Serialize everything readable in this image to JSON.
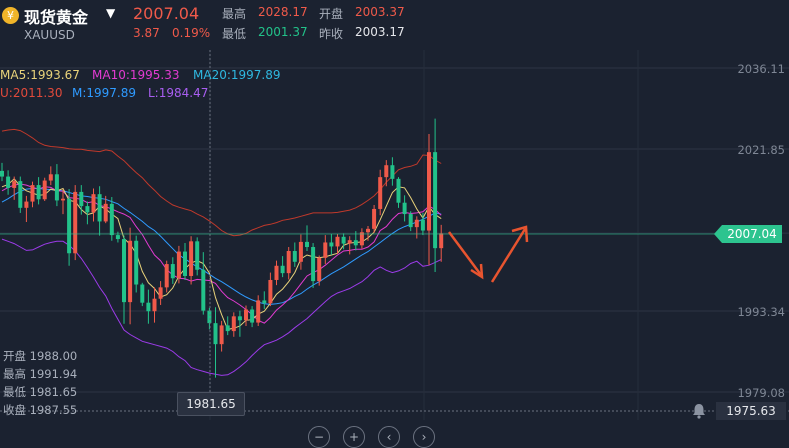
{
  "header": {
    "coin_glyph": "¥",
    "symbol_name": "现货黄金",
    "symbol_code": "XAUUSD",
    "price": "2007.04",
    "change": "3.87",
    "change_pct": "0.19%",
    "high_label": "最高",
    "high_value": "2028.17",
    "open_label": "开盘",
    "open_value": "2003.37",
    "low_label": "最低",
    "low_value": "2001.37",
    "prev_close_label": "昨收",
    "prev_close_value": "2003.17"
  },
  "indicators": {
    "ma5": "MA5:1993.67",
    "ma10": "MA10:1995.33",
    "ma20": "MA20:1997.89",
    "boll_u": "U:2011.30",
    "boll_m": "M:1997.89",
    "boll_l": "L:1984.47"
  },
  "ohlc_panel": {
    "open": "开盘 1988.00",
    "high": "最高 1991.94",
    "low": "最低 1981.65",
    "close": "收盘 1987.55"
  },
  "crosshair_low_label": "1981.65",
  "current_price_tag": "2007.04",
  "alert_price": "1975.63",
  "colors": {
    "up": "#f05a4a",
    "down": "#22c28a",
    "ma5": "#e8d27a",
    "ma10": "#e23bd1",
    "ma20": "#2f9bff",
    "boll_u": "#c0392b",
    "boll_l": "#9b3be8",
    "arrow": "#e8542f"
  },
  "chart_data": {
    "type": "candlestick",
    "y_ticks": [
      2036.11,
      2021.85,
      2007.04,
      1993.34,
      1979.08
    ],
    "ylim": [
      1975.0,
      2039.0
    ],
    "candles": [
      [
        2018.0,
        2019.4,
        2016.2,
        2017.0
      ],
      [
        2017.0,
        2018.1,
        2013.8,
        2015.0
      ],
      [
        2015.0,
        2017.0,
        2012.9,
        2016.2
      ],
      [
        2016.2,
        2017.0,
        2010.6,
        2011.5
      ],
      [
        2011.5,
        2013.6,
        2009.0,
        2012.6
      ],
      [
        2012.6,
        2016.1,
        2011.6,
        2015.5
      ],
      [
        2015.5,
        2016.9,
        2012.1,
        2013.0
      ],
      [
        2013.0,
        2016.8,
        2012.7,
        2016.3
      ],
      [
        2016.3,
        2018.8,
        2015.5,
        2017.4
      ],
      [
        2017.4,
        2019.2,
        2011.8,
        2012.8
      ],
      [
        2012.8,
        2014.7,
        2010.4,
        2013.1
      ],
      [
        2013.1,
        2014.8,
        2001.3,
        2003.5
      ],
      [
        2003.5,
        2015.5,
        2002.3,
        2014.3
      ],
      [
        2014.3,
        2015.5,
        2010.3,
        2011.8
      ],
      [
        2011.8,
        2012.6,
        2008.6,
        2010.7
      ],
      [
        2010.7,
        2014.9,
        2009.1,
        2013.9
      ],
      [
        2013.9,
        2015.3,
        2006.6,
        2009.1
      ],
      [
        2009.1,
        2013.6,
        2008.8,
        2012.2
      ],
      [
        2012.2,
        2013.4,
        2005.7,
        2006.7
      ],
      [
        2006.7,
        2007.3,
        2005.4,
        2006.0
      ],
      [
        2006.0,
        2006.6,
        1991.1,
        1994.9
      ],
      [
        1994.9,
        2008.0,
        1991.0,
        2005.7
      ],
      [
        2005.7,
        2006.6,
        1996.6,
        1998.0
      ],
      [
        1998.0,
        1998.3,
        1994.2,
        1994.8
      ],
      [
        1994.8,
        1997.1,
        1991.1,
        1993.3
      ],
      [
        1993.3,
        1997.5,
        1991.3,
        1995.5
      ],
      [
        1995.5,
        1998.6,
        1994.4,
        1997.5
      ],
      [
        1997.5,
        2002.2,
        1996.6,
        2001.6
      ],
      [
        2001.6,
        2002.8,
        1998.1,
        1999.1
      ],
      [
        1999.1,
        2004.8,
        1998.2,
        2003.8
      ],
      [
        2003.8,
        2005.3,
        1998.8,
        1999.5
      ],
      [
        1999.5,
        2006.5,
        1998.0,
        2005.6
      ],
      [
        2005.6,
        2006.3,
        1999.6,
        2000.6
      ],
      [
        2000.6,
        2003.7,
        1992.7,
        1993.4
      ],
      [
        1993.4,
        1993.9,
        1990.1,
        1991.2
      ],
      [
        1991.2,
        1994.0,
        1981.6,
        1987.5
      ],
      [
        1987.5,
        1991.6,
        1986.2,
        1990.8
      ],
      [
        1990.8,
        1992.4,
        1989.1,
        1989.8
      ],
      [
        1989.8,
        1993.1,
        1988.8,
        1992.4
      ],
      [
        1992.4,
        1993.4,
        1988.8,
        1991.7
      ],
      [
        1991.7,
        1994.3,
        1990.7,
        1993.6
      ],
      [
        1993.6,
        1994.2,
        1990.5,
        1991.3
      ],
      [
        1991.3,
        1996.1,
        1990.7,
        1995.2
      ],
      [
        1995.2,
        1996.8,
        1993.7,
        1994.7
      ],
      [
        1994.7,
        2000.1,
        1994.2,
        1998.8
      ],
      [
        1998.8,
        2002.2,
        1997.9,
        2001.3
      ],
      [
        2001.3,
        2003.0,
        1999.3,
        2000.0
      ],
      [
        2000.0,
        2004.6,
        1998.9,
        2003.9
      ],
      [
        2003.9,
        2005.4,
        2001.1,
        2002.0
      ],
      [
        2002.0,
        2006.8,
        2000.6,
        2005.5
      ],
      [
        2005.5,
        2008.4,
        2003.9,
        2004.6
      ],
      [
        2004.6,
        2005.3,
        1997.4,
        1998.6
      ],
      [
        1998.6,
        2003.1,
        1997.8,
        2002.7
      ],
      [
        2002.7,
        2006.7,
        2001.6,
        2005.4
      ],
      [
        2005.4,
        2006.9,
        2003.2,
        2004.7
      ],
      [
        2004.7,
        2006.9,
        2003.4,
        2006.4
      ],
      [
        2006.4,
        2007.0,
        2004.2,
        2005.2
      ],
      [
        2005.2,
        2006.5,
        2003.3,
        2005.8
      ],
      [
        2005.8,
        2007.4,
        2004.0,
        2004.9
      ],
      [
        2004.9,
        2007.9,
        2004.3,
        2007.2
      ],
      [
        2007.2,
        2008.3,
        2005.7,
        2007.8
      ],
      [
        2007.8,
        2012.0,
        2007.1,
        2011.3
      ],
      [
        2011.3,
        2018.2,
        2010.2,
        2016.9
      ],
      [
        2016.9,
        2019.9,
        2015.3,
        2019.0
      ],
      [
        2019.0,
        2020.4,
        2015.4,
        2016.6
      ],
      [
        2016.6,
        2016.9,
        2011.5,
        2012.4
      ],
      [
        2012.4,
        2013.7,
        2009.1,
        2010.4
      ],
      [
        2010.4,
        2010.9,
        2007.4,
        2008.1
      ],
      [
        2008.1,
        2010.0,
        2006.1,
        2009.4
      ],
      [
        2009.4,
        2010.6,
        2006.7,
        2007.5
      ],
      [
        2007.5,
        2024.5,
        2001.4,
        2021.3
      ],
      [
        2021.3,
        2027.2,
        2000.2,
        2004.4
      ],
      [
        2004.4,
        2008.5,
        2002.0,
        2007.0
      ]
    ],
    "ma5": [
      2015.2,
      2015.6,
      2016.6,
      2015.3,
      2014.5,
      2014.1,
      2013.7,
      2013.8,
      2014.8,
      2014.5,
      2014.9,
      2012.8,
      2012.6,
      2011.2,
      2010.3,
      2010.6,
      2011.8,
      2011.3,
      2010.4,
      2009.6,
      2006.1,
      2005.1,
      2003.5,
      2000.3,
      1998.3,
      1997.3,
      1995.8,
      1996.2,
      1997.4,
      1999.5,
      2000.8,
      2001.8,
      2002.2,
      2001.7,
      2000.0,
      1995.7,
      1992.7,
      1990.1,
      1990.3,
      1990.7,
      1991.7,
      1991.8,
      1992.8,
      1993.3,
      1994.7,
      1996.3,
      1997.2,
      1998.5,
      2000.1,
      2002.5,
      2003.2,
      2002.9,
      2002.7,
      2002.9,
      2003.2,
      2003.5,
      2004.9,
      2005.3,
      2005.4,
      2005.5,
      2006.2,
      2007.2,
      2009.4,
      2011.8,
      2014.2,
      2015.2,
      2015.0,
      2013.3,
      2011.3,
      2009.7,
      2011.7,
      2010.3,
      2009.6
    ],
    "ma10": [
      2014.5,
      2015.1,
      2015.5,
      2015.7,
      2015.5,
      2015.1,
      2014.8,
      2015.2,
      2015.1,
      2014.5,
      2014.4,
      2013.3,
      2013.2,
      2013.0,
      2012.4,
      2012.6,
      2011.9,
      2011.7,
      2011.3,
      2010.8,
      2010.4,
      2009.8,
      2008.2,
      2006.8,
      2004.9,
      2003.2,
      2002.2,
      2000.6,
      1999.7,
      1999.1,
      1999.0,
      1998.6,
      1998.9,
      1998.8,
      1998.7,
      1998.2,
      1996.8,
      1995.7,
      1995.1,
      1994.4,
      1993.6,
      1992.7,
      1991.7,
      1991.2,
      1992.2,
      1993.5,
      1994.4,
      1995.4,
      1996.7,
      1998.1,
      1999.5,
      2000.1,
      2000.6,
      2001.4,
      2002.3,
      2003.2,
      2003.9,
      2004.0,
      2004.2,
      2004.2,
      2004.6,
      2005.5,
      2007.5,
      2008.2,
      2009.5,
      2010.5,
      2010.7,
      2010.5,
      2010.6,
      2010.8,
      2011.8,
      2011.2,
      2010.2
    ],
    "ma20": [
      2012.5,
      2013.1,
      2013.8,
      2014.4,
      2014.8,
      2014.9,
      2014.9,
      2014.8,
      2014.7,
      2014.6,
      2014.5,
      2014.2,
      2013.9,
      2013.6,
      2013.5,
      2013.3,
      2013.2,
      2013.0,
      2012.6,
      2012.2,
      2011.4,
      2010.7,
      2009.9,
      2009.1,
      2008.2,
      2007.5,
      2006.5,
      2005.4,
      2004.3,
      2003.2,
      2002.5,
      2001.8,
      2001.1,
      2000.5,
      1999.8,
      1999.1,
      1998.5,
      1997.8,
      1997.1,
      1996.4,
      1995.8,
      1995.3,
      1994.9,
      1994.6,
      1994.5,
      1994.6,
      1994.8,
      1995.3,
      1995.9,
      1996.4,
      1997.2,
      1997.9,
      1998.5,
      1999.2,
      1999.9,
      2000.5,
      2001.1,
      2001.8,
      2002.5,
      2003.2,
      2003.8,
      2004.6,
      2005.4,
      2006.2,
      2007.0,
      2007.7,
      2008.2,
      2008.6,
      2009.0,
      2009.5,
      2010.0,
      2010.6,
      2010.4
    ],
    "boll_u": [
      2025.0,
      2025.2,
      2025.3,
      2025.1,
      2024.5,
      2023.8,
      2023.0,
      2022.5,
      2022.3,
      2022.2,
      2022.1,
      2021.9,
      2021.8,
      2021.8,
      2021.6,
      2021.5,
      2021.4,
      2021.7,
      2021.5,
      2020.6,
      2019.8,
      2018.7,
      2017.7,
      2016.8,
      2015.6,
      2014.6,
      2013.5,
      2012.7,
      2012.0,
      2011.6,
      2011.3,
      2011.0,
      2010.4,
      2009.9,
      2009.2,
      2008.4,
      2007.5,
      2006.9,
      2006.6,
      2006.7,
      2007.0,
      2007.6,
      2008.0,
      2008.4,
      2008.6,
      2008.9,
      2009.3,
      2009.5,
      2009.7,
      2010.0,
      2010.3,
      2010.6,
      2010.6,
      2010.6,
      2010.6,
      2010.7,
      2010.9,
      2011.1,
      2011.5,
      2012.1,
      2012.8,
      2013.6,
      2014.7,
      2016.0,
      2017.1,
      2018.2,
      2018.6,
      2018.8,
      2019.2,
      2020.8,
      2020.7,
      2019.9,
      2019.3
    ],
    "boll_l": [
      2006.0,
      2005.6,
      2005.2,
      2004.6,
      2004.0,
      2004.1,
      2004.6,
      2005.1,
      2005.4,
      2005.6,
      2005.6,
      2004.9,
      2003.9,
      2002.6,
      2001.0,
      1999.3,
      1997.5,
      1996.0,
      1993.8,
      1991.9,
      1990.0,
      1989.2,
      1988.6,
      1988.0,
      1987.7,
      1987.4,
      1987.1,
      1986.8,
      1986.2,
      1985.3,
      1984.6,
      1983.4,
      1983.0,
      1982.7,
      1982.4,
      1982.2,
      1982.0,
      1982.1,
      1982.7,
      1983.5,
      1984.4,
      1985.5,
      1986.5,
      1987.4,
      1987.8,
      1988.2,
      1988.8,
      1989.5,
      1990.4,
      1991.2,
      1992.0,
      1993.0,
      1994.0,
      1995.0,
      1995.9,
      1996.5,
      1996.9,
      1997.3,
      1997.9,
      1998.5,
      1999.4,
      2000.5,
      2001.1,
      2000.5,
      2000.1,
      2000.4,
      2000.9,
      2001.7,
      2002.1,
      2001.2,
      2001.4,
      2001.9,
      2002.4
    ]
  }
}
